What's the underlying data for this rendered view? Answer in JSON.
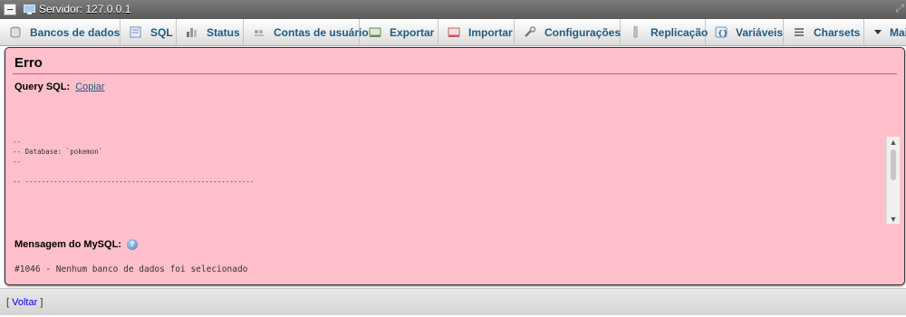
{
  "server_bar": {
    "label": "Servidor: 127.0.0.1"
  },
  "tabs": [
    {
      "label": "Bancos de dados",
      "icon": "database-icon"
    },
    {
      "label": "SQL",
      "icon": "sql-icon"
    },
    {
      "label": "Status",
      "icon": "status-icon"
    },
    {
      "label": "Contas de usuário",
      "icon": "users-icon"
    },
    {
      "label": "Exportar",
      "icon": "export-icon"
    },
    {
      "label": "Importar",
      "icon": "import-icon"
    },
    {
      "label": "Configurações",
      "icon": "wrench-icon"
    },
    {
      "label": "Replicação",
      "icon": "replication-icon"
    },
    {
      "label": "Variáveis",
      "icon": "variables-icon"
    },
    {
      "label": "Charsets",
      "icon": "charsets-icon"
    },
    {
      "label": "Mais",
      "icon": "caret-down-icon"
    }
  ],
  "error": {
    "title": "Erro",
    "query_label": "Query SQL:",
    "copy_link": "Copiar",
    "code": "--\n-- Database: `pokemon`\n--\n\n-- --------------------------------------------------------",
    "mysql_label": "Mensagem do MySQL:",
    "message": "#1046 - Nenhum banco de dados foi selecionado"
  },
  "back": {
    "open": "[ ",
    "link": "Voltar",
    "close": " ]"
  }
}
